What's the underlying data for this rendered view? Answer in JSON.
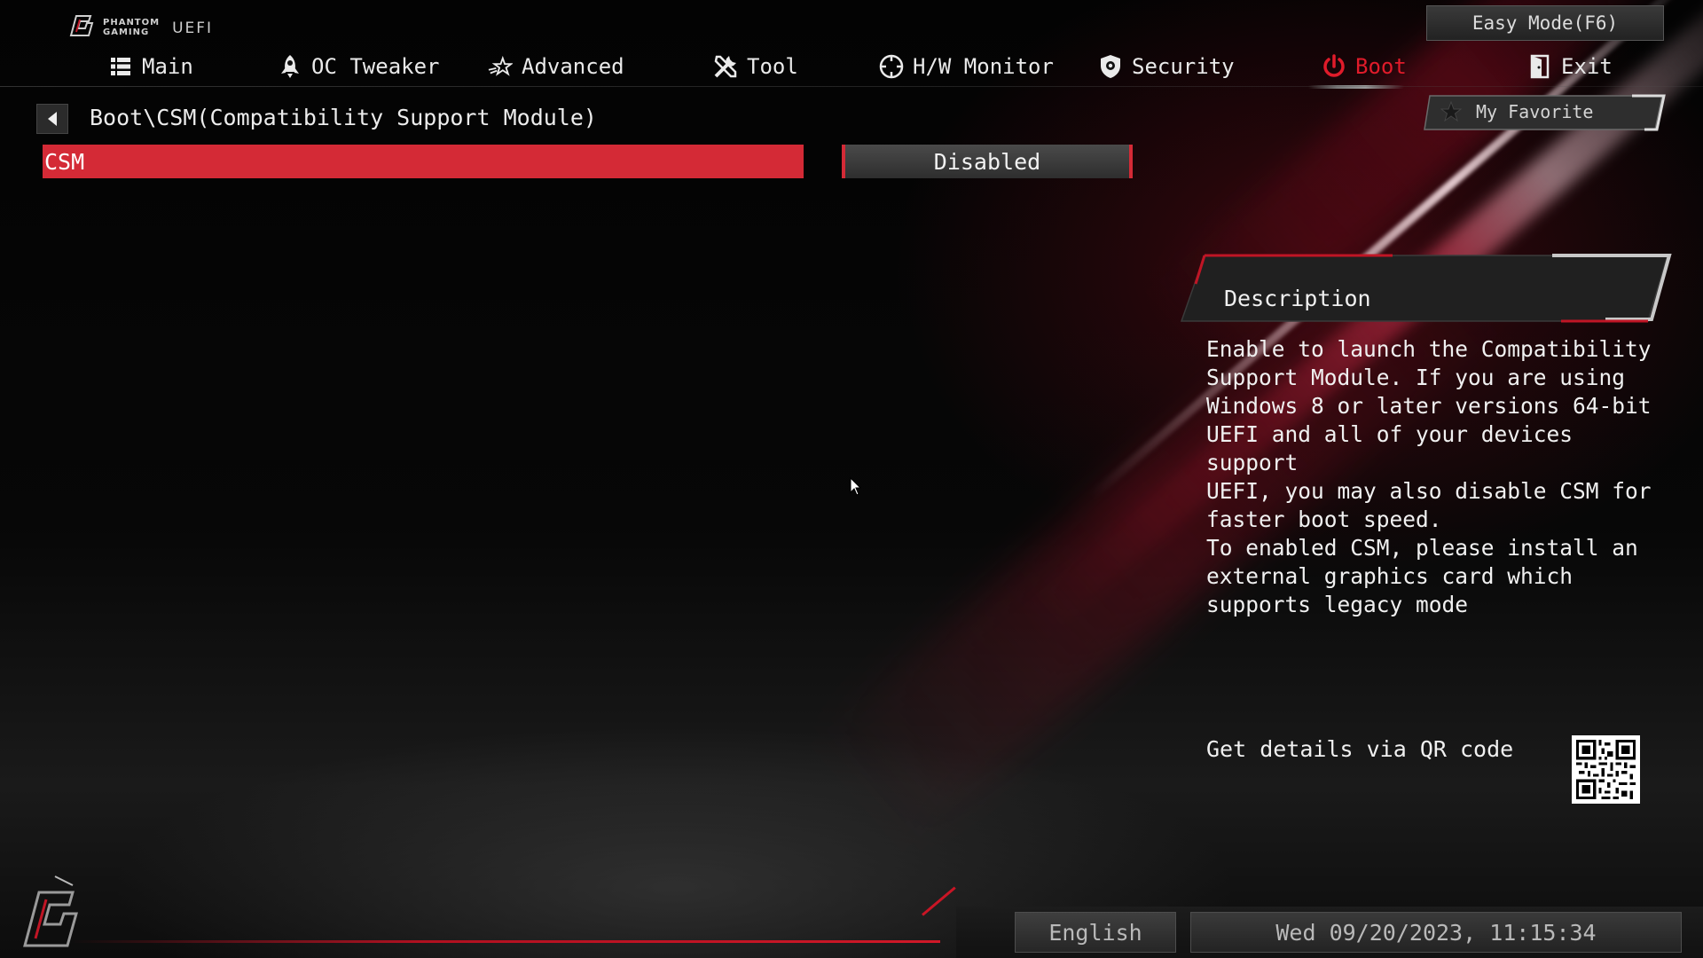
{
  "header": {
    "logo_line1": "PHANTOM",
    "logo_line2": "GAMING",
    "logo_product": "UEFI",
    "easy_mode_label": "Easy Mode(F6)"
  },
  "tabs": [
    {
      "label": "Main",
      "icon": "list-icon",
      "active": false
    },
    {
      "label": "OC Tweaker",
      "icon": "rocket-icon",
      "active": false
    },
    {
      "label": "Advanced",
      "icon": "star-swoosh-icon",
      "active": false
    },
    {
      "label": "Tool",
      "icon": "tools-icon",
      "active": false
    },
    {
      "label": "H/W Monitor",
      "icon": "crosshair-icon",
      "active": false
    },
    {
      "label": "Security",
      "icon": "shield-icon",
      "active": false
    },
    {
      "label": "Boot",
      "icon": "power-icon",
      "active": true
    },
    {
      "label": "Exit",
      "icon": "exit-door-icon",
      "active": false
    }
  ],
  "favorite": {
    "label": "My Favorite",
    "icon": "star-icon"
  },
  "breadcrumb": "Boot\\CSM(Compatibility Support Module)",
  "settings": [
    {
      "label": "CSM",
      "value": "Disabled",
      "selected": true
    }
  ],
  "description": {
    "title": "Description",
    "lines": [
      "Enable to launch the Compatibility",
      "Support Module. If you are using",
      "Windows 8 or later versions 64-bit",
      "UEFI and all of your devices support",
      "UEFI, you may also disable CSM for",
      "faster boot speed.",
      "To enabled CSM, please install an",
      "external graphics card which",
      "supports legacy mode"
    ]
  },
  "qr": {
    "label": "Get details via QR code"
  },
  "footer": {
    "language": "English",
    "datetime": "Wed 09/20/2023, 11:15:34"
  },
  "colors": {
    "accent": "#d42a36",
    "active_tab": "#e01b2a",
    "background": "#050505",
    "text": "#ececec"
  }
}
